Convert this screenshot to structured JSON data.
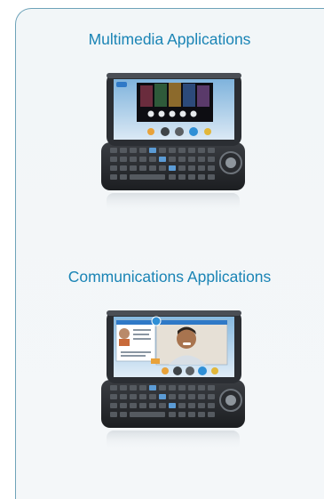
{
  "sections": [
    {
      "title": "Multimedia Applications"
    },
    {
      "title": "Communications Applications"
    }
  ]
}
